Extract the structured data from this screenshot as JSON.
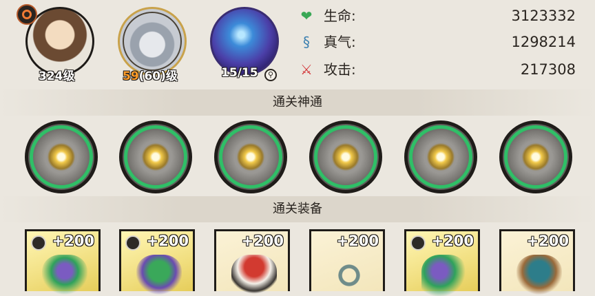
{
  "header": {
    "character": {
      "level_label": "324级"
    },
    "pet": {
      "level_current": "59",
      "level_rest": "(60)级"
    },
    "star_chart": {
      "count_label": "15/15"
    }
  },
  "stats": [
    {
      "icon": "heart-plus-icon",
      "name": "生命:",
      "value": "3123332"
    },
    {
      "icon": "swirl-icon",
      "name": "真气:",
      "value": "1298214"
    },
    {
      "icon": "sword-icon",
      "name": "攻击:",
      "value": "217308"
    }
  ],
  "sections": {
    "skills_title": "通关神通",
    "equipment_title": "通关装备"
  },
  "skills": [
    {
      "name": "skill-1"
    },
    {
      "name": "skill-2"
    },
    {
      "name": "skill-3"
    },
    {
      "name": "skill-4"
    },
    {
      "name": "skill-5"
    },
    {
      "name": "skill-6"
    }
  ],
  "equipment": [
    {
      "bonus": "+200",
      "rarity": "gold"
    },
    {
      "bonus": "+200",
      "rarity": "gold"
    },
    {
      "bonus": "+200",
      "rarity": "plain"
    },
    {
      "bonus": "+200",
      "rarity": "plain"
    },
    {
      "bonus": "+200",
      "rarity": "gold"
    },
    {
      "bonus": "+200",
      "rarity": "plain"
    }
  ],
  "colors": {
    "skill_ring": "#2fbf67",
    "level_highlight": "#ff9d2a",
    "background": "#ebe7df"
  }
}
